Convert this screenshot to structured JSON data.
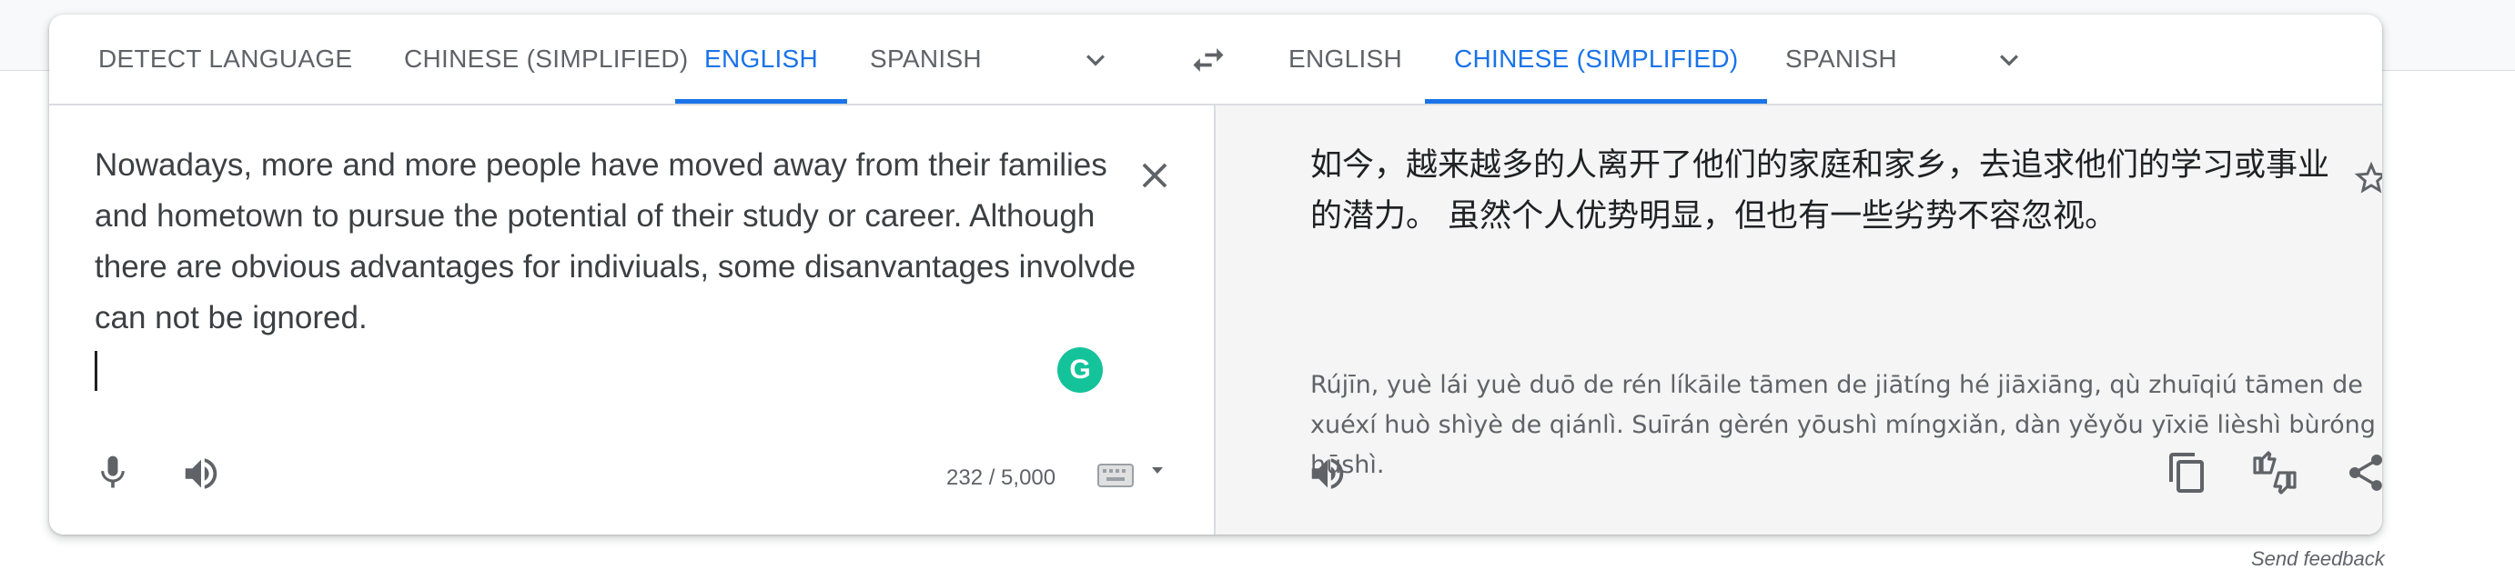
{
  "source_languages": {
    "tabs": [
      {
        "label": "DETECT LANGUAGE"
      },
      {
        "label": "CHINESE (SIMPLIFIED)"
      },
      {
        "label": "ENGLISH"
      },
      {
        "label": "SPANISH"
      }
    ],
    "active": "ENGLISH",
    "more_icon": "chevron-down-icon"
  },
  "swap_icon": "swap-arrows-icon",
  "target_languages": {
    "tabs": [
      {
        "label": "ENGLISH"
      },
      {
        "label": "CHINESE (SIMPLIFIED)"
      },
      {
        "label": "SPANISH"
      }
    ],
    "active": "CHINESE (SIMPLIFIED)",
    "more_icon": "chevron-down-icon"
  },
  "source": {
    "text": "Nowadays, more and more people have moved away from their families and hometown to pursue the potential of their study or career. Although there are obvious advantages for indiviuals, some disanvantages involvde can not be ignored.",
    "char_count": "232 / 5,000",
    "grammarly_glyph": "G"
  },
  "target": {
    "text": "如今，越来越多的人离开了他们的家庭和家乡，去追求他们的学习或事业的潜力。 虽然个人优势明显，但也有一些劣势不容忽视。",
    "pinyin": "Rújīn, yuè lái yuè duō de rén líkāile tāmen de jiātíng hé jiāxiāng, qù zhuīqiú tāmen de xuéxí huò shìyè de qiánlì. Suīrán gèrén yōushì míngxiǎn, dàn yěyǒu yīxiē lièshì bùróng hūshì."
  },
  "feedback_label": "Send feedback",
  "colors": {
    "accent": "#1a73e8",
    "muted": "#5f6368",
    "target_bg": "#f5f5f5",
    "grammarly": "#15c39a"
  }
}
